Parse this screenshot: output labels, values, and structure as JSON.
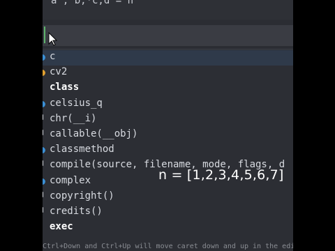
{
  "editor": {
    "top_line": "a , b,*c,d = n",
    "current_line": ""
  },
  "autocomplete": {
    "items": [
      {
        "label": "c",
        "bold": false,
        "marker": "dot",
        "marker_color": "#3b8fd4",
        "selected": true
      },
      {
        "label": "cv2",
        "bold": false,
        "marker": "dot",
        "marker_color": "#e0a030",
        "selected": false
      },
      {
        "label": "class",
        "bold": true,
        "marker": "none",
        "marker_color": "",
        "selected": false
      },
      {
        "label": "celsius_q",
        "bold": false,
        "marker": "dot",
        "marker_color": "#3b8fd4",
        "selected": false
      },
      {
        "label": "chr(__i)",
        "bold": false,
        "marker": "tick",
        "marker_color": "#d7dae0",
        "selected": false
      },
      {
        "label": "callable(__obj)",
        "bold": false,
        "marker": "tick",
        "marker_color": "#d7dae0",
        "selected": false
      },
      {
        "label": "classmethod",
        "bold": false,
        "marker": "dot",
        "marker_color": "#3b8fd4",
        "selected": false
      },
      {
        "label": "compile(source, filename, mode, flags, d",
        "bold": false,
        "marker": "tick",
        "marker_color": "#d7dae0",
        "selected": false
      },
      {
        "label": "complex",
        "bold": false,
        "marker": "dot",
        "marker_color": "#3b8fd4",
        "selected": false
      },
      {
        "label": "copyright()",
        "bold": false,
        "marker": "tick",
        "marker_color": "#d7dae0",
        "selected": false
      },
      {
        "label": "credits()",
        "bold": false,
        "marker": "tick",
        "marker_color": "#d7dae0",
        "selected": false
      },
      {
        "label": "exec",
        "bold": true,
        "marker": "none",
        "marker_color": "",
        "selected": false
      }
    ],
    "hint": "Ctrl+Down and Ctrl+Up will move caret down and up in the editor"
  },
  "overlay_caption": "n = [1,2,3,4,5,6,7]",
  "colors": {
    "background": "#2b2d33",
    "selection": "#2f3a4a",
    "caret": "#5fb36c"
  }
}
